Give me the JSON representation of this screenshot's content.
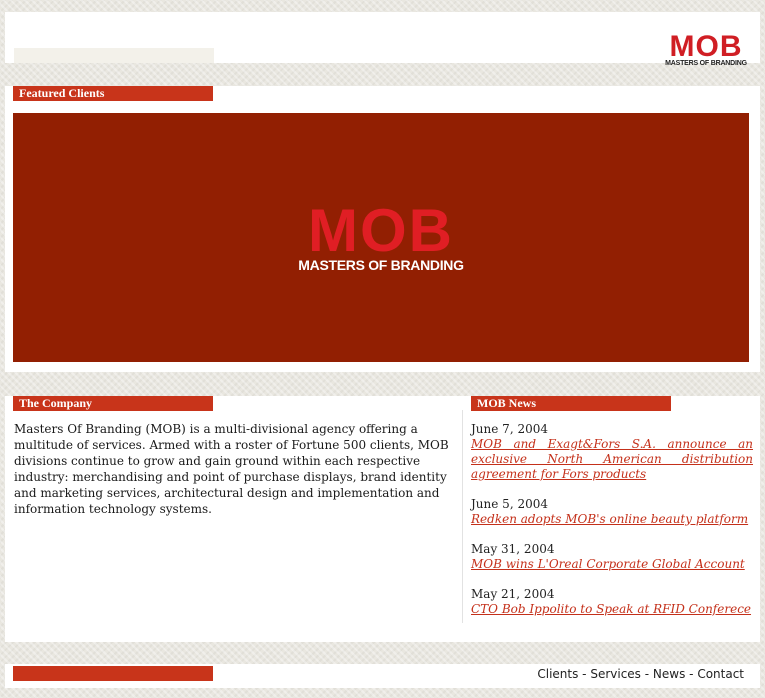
{
  "header": {
    "logo": {
      "mark": "MOB",
      "tagline": "MASTERS OF BRANDING"
    }
  },
  "featured": {
    "title": "Featured Clients",
    "banner_logo": {
      "mark": "MOB",
      "tagline": "MASTERS OF BRANDING"
    }
  },
  "company": {
    "title": "The Company",
    "text": "Masters Of Branding (MOB) is a multi-divisional agency offering a multitude of services. Armed with a roster of Fortune 500 clients, MOB divisions continue to grow and gain ground within each respective industry: merchandising and point of purchase displays, brand identity and marketing services, architectural design and implementation and information technology systems."
  },
  "news": {
    "title": "MOB News",
    "items": [
      {
        "date": "June 7, 2004",
        "headline": "MOB and Exagt&Fors S.A. announce an exclusive North American distribution agreement for Fors products"
      },
      {
        "date": "June 5, 2004",
        "headline": "Redken adopts MOB's online beauty platform"
      },
      {
        "date": "May 31, 2004",
        "headline": "MOB wins L'Oreal Corporate Global Account"
      },
      {
        "date": "May 21, 2004",
        "headline": "CTO Bob Ippolito to Speak at RFID Conferece"
      }
    ]
  },
  "footer": {
    "nav": [
      "Clients",
      "Services",
      "News",
      "Contact"
    ],
    "separator": " - "
  },
  "colors": {
    "accent": "#c8341a",
    "banner": "#921f02",
    "logo_red": "#d01e24"
  }
}
